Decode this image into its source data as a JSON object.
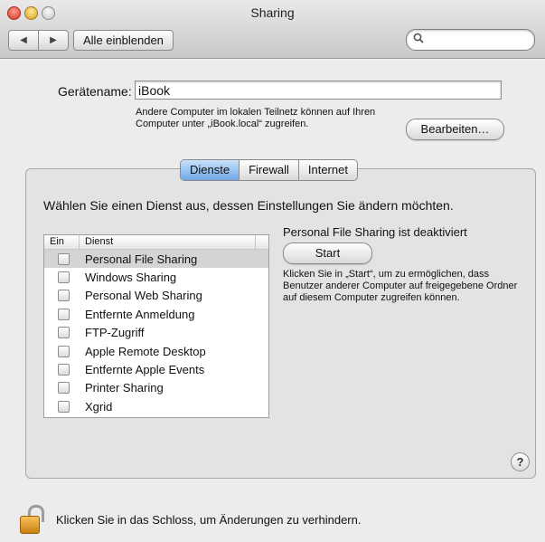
{
  "window": {
    "title": "Sharing",
    "show_all_label": "Alle einblenden",
    "back_glyph": "◀",
    "forward_glyph": "▶",
    "search_icon_glyph": "🔍"
  },
  "computer_name": {
    "label": "Gerätename:",
    "value": "iBook",
    "description": "Andere Computer im lokalen Teilnetz können auf Ihren Computer unter „iBook.local“ zugreifen.",
    "edit_button": "Bearbeiten…"
  },
  "tabs": [
    {
      "label": "Dienste",
      "active": true
    },
    {
      "label": "Firewall",
      "active": false
    },
    {
      "label": "Internet",
      "active": false
    }
  ],
  "instruction": "Wählen Sie einen Dienst aus, dessen Einstellungen Sie ändern möchten.",
  "service_list": {
    "col_on": "Ein",
    "col_service": "Dienst",
    "services": [
      {
        "label": "Personal File Sharing",
        "checked": false,
        "selected": true
      },
      {
        "label": "Windows Sharing",
        "checked": false,
        "selected": false
      },
      {
        "label": "Personal Web Sharing",
        "checked": false,
        "selected": false
      },
      {
        "label": "Entfernte Anmeldung",
        "checked": false,
        "selected": false
      },
      {
        "label": "FTP-Zugriff",
        "checked": false,
        "selected": false
      },
      {
        "label": "Apple Remote Desktop",
        "checked": false,
        "selected": false
      },
      {
        "label": "Entfernte Apple Events",
        "checked": false,
        "selected": false
      },
      {
        "label": "Printer Sharing",
        "checked": false,
        "selected": false
      },
      {
        "label": "Xgrid",
        "checked": false,
        "selected": false
      }
    ]
  },
  "detail": {
    "status": "Personal File Sharing ist deaktiviert",
    "start_button": "Start",
    "help_text": "Klicken Sie in „Start“, um zu ermöglichen, dass Benutzer anderer Computer auf freigegebene Ordner auf diesem Computer zugreifen können."
  },
  "help_button": "?",
  "lock_text": "Klicken Sie in das Schloss, um Änderungen zu verhindern."
}
